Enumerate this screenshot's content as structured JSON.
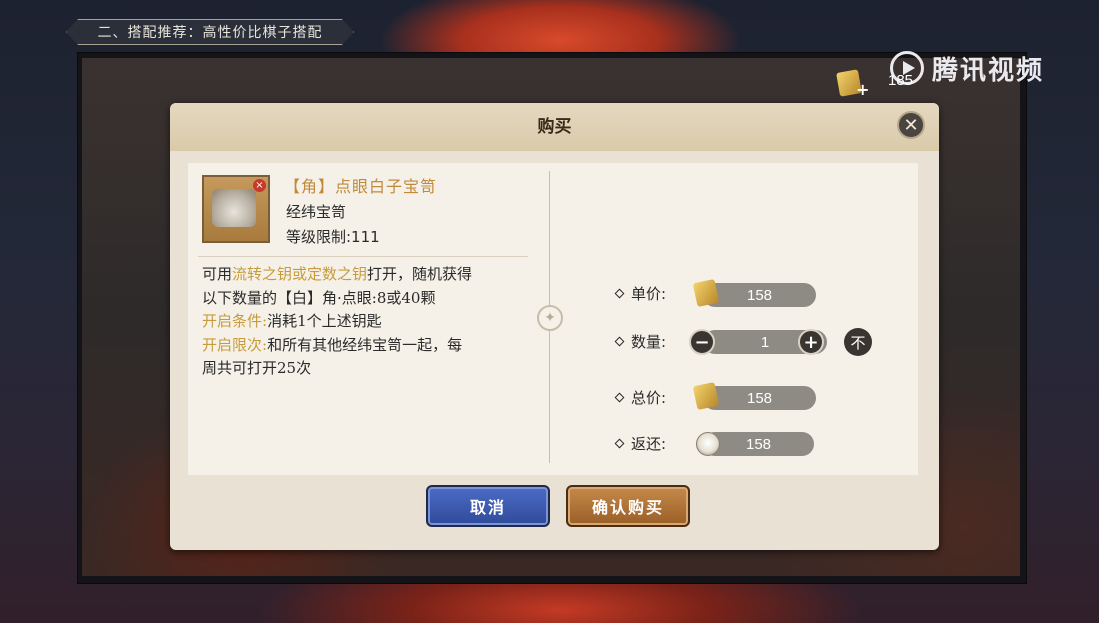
{
  "banner": {
    "text": "二、搭配推荐：高性价比棋子搭配"
  },
  "top_currency": {
    "count": "185",
    "plus": "+"
  },
  "watermark": {
    "text": "腾讯视频"
  },
  "dialog": {
    "title": "购买",
    "close_glyph": "✕",
    "item": {
      "name": "【角】点眼白子宝笥",
      "type": "经纬宝笥",
      "level_label": "等级限制:111"
    },
    "description": {
      "line1_a": "可用",
      "line1_b": "流转之钥或定数之钥",
      "line1_c": "打开，随机获得",
      "line2": "以下数量的【白】角·点眼:8或40颗",
      "line3_a": "开启条件:",
      "line3_b": "消耗1个上述钥匙",
      "line4_a": "开启限次:",
      "line4_b": "和所有其他经纬宝笥一起，每",
      "line5": "周共可打开25次"
    },
    "purchase": {
      "unit_price_label": "单价:",
      "unit_price": "158",
      "quantity_label": "数量:",
      "quantity": "1",
      "minus_glyph": "−",
      "plus_glyph": "+",
      "max_glyph": "不",
      "total_label": "总价:",
      "total": "158",
      "refund_label": "返还:",
      "refund": "158"
    },
    "buttons": {
      "cancel": "取消",
      "confirm": "确认购买"
    }
  },
  "colors": {
    "dialog_bg": "#e9e2d4",
    "gold_text": "#c79b3b",
    "cancel_button": "#3a58b0",
    "confirm_button": "#b0743a"
  },
  "icons": [
    "gold-ticket-icon",
    "refund-coin-icon",
    "close-icon",
    "minus-icon",
    "plus-icon",
    "max-icon",
    "tencent-video-logo-icon"
  ]
}
